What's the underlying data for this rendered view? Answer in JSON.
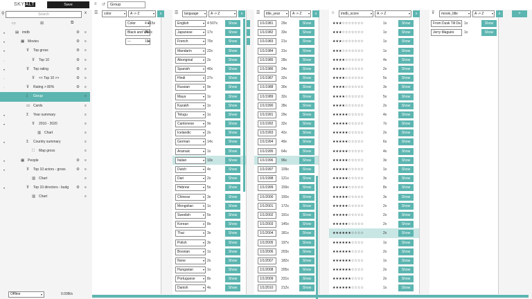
{
  "app": {
    "logo_a": "SKY",
    "logo_b": "ALT",
    "save_label": "Save",
    "title_value": "Group"
  },
  "sidebar": {
    "search_placeholder": "Search",
    "items": [
      {
        "label": "imdb",
        "icon": "database-icon",
        "arrow": "▾"
      },
      {
        "label": "Movies",
        "icon": "table-icon",
        "arrow": "▾"
      },
      {
        "label": "Top gross",
        "icon": "filter-icon",
        "arrow": "▾"
      },
      {
        "label": "Top 10",
        "icon": "filter-icon",
        "arrow": "◦"
      },
      {
        "label": "Top rating",
        "icon": "filter-icon",
        "arrow": "▾"
      },
      {
        "label": "<< Top 10 >>",
        "icon": "filter-icon",
        "arrow": "◦"
      },
      {
        "label": "Rating > 80%",
        "icon": "filter-icon",
        "arrow": "◦"
      },
      {
        "label": "Group",
        "icon": "group-icon",
        "arrow": ""
      },
      {
        "label": "Cards",
        "icon": "cards-icon",
        "arrow": ""
      },
      {
        "label": "Year summary",
        "icon": "sum-icon",
        "arrow": "▾"
      },
      {
        "label": "2010 - 2020",
        "icon": "filter-icon",
        "arrow": "▾"
      },
      {
        "label": "Chart",
        "icon": "chart-icon",
        "arrow": ""
      },
      {
        "label": "Country summary",
        "icon": "sum-icon",
        "arrow": "▾"
      },
      {
        "label": "Map gross",
        "icon": "map-icon",
        "arrow": ""
      },
      {
        "label": "People",
        "icon": "table-icon",
        "arrow": "▾"
      },
      {
        "label": "Top 10 actors - gross",
        "icon": "filter-icon",
        "arrow": "▾"
      },
      {
        "label": "Chart",
        "icon": "chart-icon",
        "arrow": ""
      },
      {
        "label": "Top 10 directors - budg",
        "icon": "filter-icon",
        "arrow": "▾"
      },
      {
        "label": "Chart",
        "icon": "chart-icon",
        "arrow": ""
      }
    ],
    "status": "Offline",
    "rate": "0.00B/s"
  },
  "panels": [
    {
      "field": "color",
      "sort": "A -> Z",
      "x": "x",
      "rows": [
        {
          "v": "Color",
          "c": "4 815x"
        },
        {
          "v": "Black and Wh",
          "c": "209x"
        },
        {
          "v": "---",
          "c": "19x"
        }
      ]
    },
    {
      "field": "language",
      "sort": "A -> Z",
      "x": "x",
      "rows": [
        {
          "v": "English",
          "c": "4 507x"
        },
        {
          "v": "Japanese",
          "c": "17x"
        },
        {
          "v": "French",
          "c": "70x"
        },
        {
          "v": "Mandarin",
          "c": "22x"
        },
        {
          "v": "Aboriginal",
          "c": "2x"
        },
        {
          "v": "Spanish",
          "c": "40x"
        },
        {
          "v": "Hindi",
          "c": "27x"
        },
        {
          "v": "Russian",
          "c": "9x"
        },
        {
          "v": "Maya",
          "c": "1x"
        },
        {
          "v": "Kazakh",
          "c": "1x"
        },
        {
          "v": "Telugu",
          "c": "1x"
        },
        {
          "v": "Cantonese",
          "c": "9x"
        },
        {
          "v": "Icelandic",
          "c": "2x"
        },
        {
          "v": "German",
          "c": "14x"
        },
        {
          "v": "Aramaic",
          "c": "1x"
        },
        {
          "v": "Italian",
          "c": "10x"
        },
        {
          "v": "Dutch",
          "c": "4x"
        },
        {
          "v": "Dari",
          "c": "2x"
        },
        {
          "v": "Hebrew",
          "c": "5x"
        },
        {
          "v": "Chinese",
          "c": "3x"
        },
        {
          "v": "Mongolian",
          "c": "1x"
        },
        {
          "v": "Swedish",
          "c": "5x"
        },
        {
          "v": "Korean",
          "c": "8x"
        },
        {
          "v": "Thai",
          "c": "3x"
        },
        {
          "v": "Polish",
          "c": "3x"
        },
        {
          "v": "Bosnian",
          "c": "1x"
        },
        {
          "v": "None",
          "c": "2x"
        },
        {
          "v": "Hungarian",
          "c": "1x"
        },
        {
          "v": "Portuguese",
          "c": "8x"
        },
        {
          "v": "Danish",
          "c": "4x"
        }
      ]
    },
    {
      "field": "title_year",
      "sort": "A -> Z",
      "x": "x",
      "rows": [
        {
          "v": "1/1/1981",
          "c": "29x"
        },
        {
          "v": "1/1/1982",
          "c": "33x"
        },
        {
          "v": "1/1/1983",
          "c": "21x"
        },
        {
          "v": "1/1/1984",
          "c": "31x"
        },
        {
          "v": "1/1/1985",
          "c": "28x"
        },
        {
          "v": "1/1/1986",
          "c": "24x"
        },
        {
          "v": "1/1/1987",
          "c": "32x"
        },
        {
          "v": "1/1/1988",
          "c": "30x"
        },
        {
          "v": "1/1/1989",
          "c": "32x"
        },
        {
          "v": "1/1/1990",
          "c": "28x"
        },
        {
          "v": "1/1/1991",
          "c": "29x"
        },
        {
          "v": "1/1/1992",
          "c": "32x"
        },
        {
          "v": "1/1/1993",
          "c": "42x"
        },
        {
          "v": "1/1/1994",
          "c": "49x"
        },
        {
          "v": "1/1/1995",
          "c": "64x"
        },
        {
          "v": "1/1/1996",
          "c": "96x"
        },
        {
          "v": "1/1/1997",
          "c": "109x"
        },
        {
          "v": "1/1/1998",
          "c": "121x"
        },
        {
          "v": "1/1/1999",
          "c": "159x"
        },
        {
          "v": "1/1/2000",
          "c": "150x"
        },
        {
          "v": "1/1/2001",
          "c": "172x"
        },
        {
          "v": "1/1/2002",
          "c": "191x"
        },
        {
          "v": "1/1/2003",
          "c": "145x"
        },
        {
          "v": "1/1/2004",
          "c": "181x"
        },
        {
          "v": "1/1/2005",
          "c": "197x"
        },
        {
          "v": "1/1/2006",
          "c": "203x"
        },
        {
          "v": "1/1/2007",
          "c": "182x"
        },
        {
          "v": "1/1/2008",
          "c": "205x"
        },
        {
          "v": "1/1/2009",
          "c": "231x"
        },
        {
          "v": "1/1/2010",
          "c": "212x"
        }
      ]
    },
    {
      "field": "imdb_score",
      "sort": "A -> Z",
      "x": "x",
      "rows": [
        {
          "v": "★★★☆☆☆☆☆☆☆",
          "c": "1x"
        },
        {
          "v": "★★★☆☆☆☆☆☆☆",
          "c": "1x"
        },
        {
          "v": "★★★☆☆☆☆☆☆☆",
          "c": "1x"
        },
        {
          "v": "★★★☆☆☆☆☆☆☆",
          "c": "1x"
        },
        {
          "v": "★★★★☆☆☆☆☆☆",
          "c": "4x"
        },
        {
          "v": "★★★★☆☆☆☆☆☆",
          "c": "2x"
        },
        {
          "v": "★★★★☆☆☆☆☆☆",
          "c": "5x"
        },
        {
          "v": "★★★★☆☆☆☆☆☆",
          "c": "3x"
        },
        {
          "v": "★★★★☆☆☆☆☆☆",
          "c": "5x"
        },
        {
          "v": "★★★★☆☆☆☆☆☆",
          "c": "2x"
        },
        {
          "v": "★★★★★☆☆☆☆☆",
          "c": "4x"
        },
        {
          "v": "★★★★★☆☆☆☆☆",
          "c": "7x"
        },
        {
          "v": "★★★★★☆☆☆☆☆",
          "c": "2x"
        },
        {
          "v": "★★★★★☆☆☆☆☆",
          "c": "6x"
        },
        {
          "v": "★★★★★☆☆☆☆☆",
          "c": "4x"
        },
        {
          "v": "★★★★★☆☆☆☆☆",
          "c": "3x"
        },
        {
          "v": "★★★★★☆☆☆☆☆",
          "c": "1x"
        },
        {
          "v": "★★★★★☆☆☆☆☆",
          "c": "3x"
        },
        {
          "v": "★★★★★☆☆☆☆☆",
          "c": "8x"
        },
        {
          "v": "★★★★★☆☆☆☆☆",
          "c": "3x"
        },
        {
          "v": "★★★★★☆☆☆☆☆",
          "c": "2x"
        },
        {
          "v": "★★★★★☆☆☆☆☆",
          "c": "2x"
        },
        {
          "v": "★★★★★☆☆☆☆☆",
          "c": "2x"
        },
        {
          "v": "★★★★★★☆☆☆☆",
          "c": "2x"
        },
        {
          "v": "★★★★★★☆☆☆☆",
          "c": "1x"
        },
        {
          "v": "★★★★★★☆☆☆☆",
          "c": "2x"
        },
        {
          "v": "★★★★★★☆☆☆☆",
          "c": "1x"
        },
        {
          "v": "★★★★★★☆☆☆☆",
          "c": "2x"
        },
        {
          "v": "★★★★★★☆☆☆☆",
          "c": "2x"
        },
        {
          "v": "★★★★★★☆☆☆☆",
          "c": "1x"
        }
      ]
    },
    {
      "field": "movie_title",
      "sort": "A -> Z",
      "x": "x",
      "rows": [
        {
          "v": "From Dusk Till Da",
          "c": "1x"
        },
        {
          "v": "Jerry Maguire",
          "c": "1x"
        }
      ]
    }
  ],
  "show_label": "Show",
  "add_label": "+"
}
